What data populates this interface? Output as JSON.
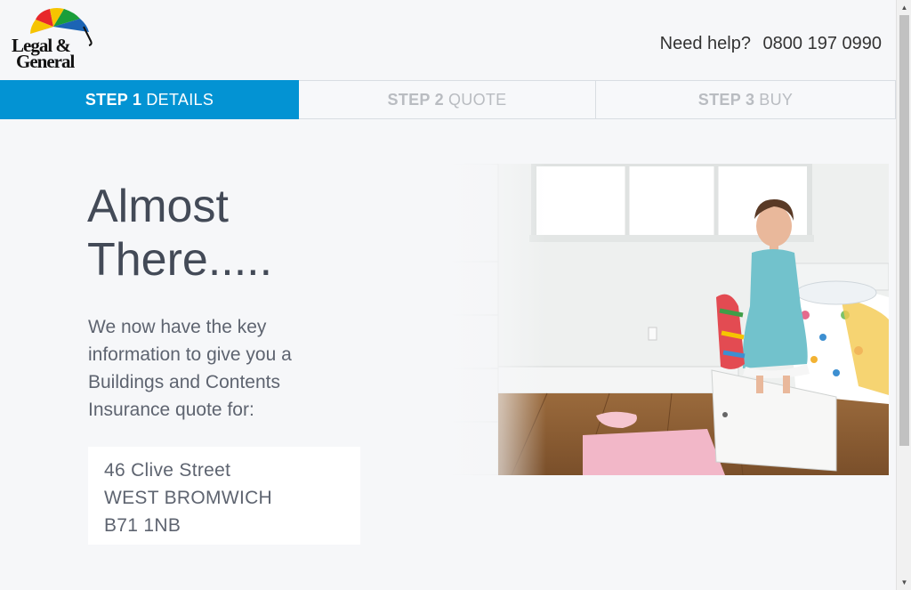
{
  "brand": {
    "logo_line1": "Legal &",
    "logo_line2": "General"
  },
  "header": {
    "help_label": "Need help?",
    "phone": "0800 197 0990"
  },
  "steps": [
    {
      "num": "STEP 1",
      "label": "DETAILS",
      "active": true
    },
    {
      "num": "STEP 2",
      "label": "QUOTE",
      "active": false
    },
    {
      "num": "STEP 3",
      "label": "BUY",
      "active": false
    }
  ],
  "main": {
    "headline_line1": "Almost",
    "headline_line2": "There.....",
    "intro": "We now have the key information to give you a Buildings and Contents Insurance quote for:",
    "address": [
      "46 Clive Street",
      "WEST BROMWICH",
      "B71 1NB"
    ]
  },
  "colors": {
    "accent": "#0393d3",
    "background": "#f6f7f9",
    "heading": "#434a57",
    "body_text": "#5e6470"
  }
}
